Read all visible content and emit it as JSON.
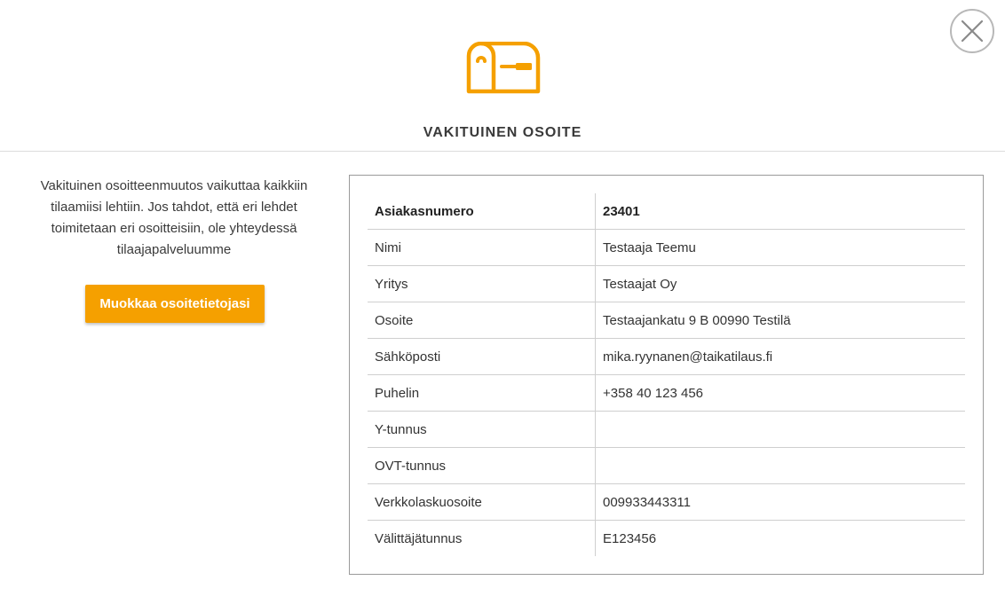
{
  "header": {
    "title": "VAKITUINEN OSOITE",
    "icon": "mailbox-icon",
    "close_icon": "close-icon"
  },
  "info": {
    "text": "Vakituinen osoitteenmuutos vaikuttaa kaikkiin tilaamiisi lehtiin. Jos tahdot, että eri lehdet toimitetaan eri osoitteisiin, ole yhteydessä tilaajapalveluumme"
  },
  "actions": {
    "edit_label": "Muokkaa osoitetietojasi"
  },
  "details": {
    "rows": [
      {
        "label": "Asiakasnumero",
        "value": "23401"
      },
      {
        "label": "Nimi",
        "value": "Testaaja Teemu"
      },
      {
        "label": "Yritys",
        "value": "Testaajat Oy"
      },
      {
        "label": "Osoite",
        "value": "Testaajankatu 9 B 00990 Testilä"
      },
      {
        "label": "Sähköposti",
        "value": "mika.ryynanen@taikatilaus.fi"
      },
      {
        "label": "Puhelin",
        "value": "+358 40 123 456"
      },
      {
        "label": "Y-tunnus",
        "value": ""
      },
      {
        "label": "OVT-tunnus",
        "value": ""
      },
      {
        "label": "Verkkolaskuosoite",
        "value": "009933443311"
      },
      {
        "label": "Välittäjätunnus",
        "value": "E123456"
      }
    ]
  },
  "colors": {
    "accent": "#f5a000",
    "border": "#9a9a9a",
    "close_border": "#b8b8b8"
  }
}
